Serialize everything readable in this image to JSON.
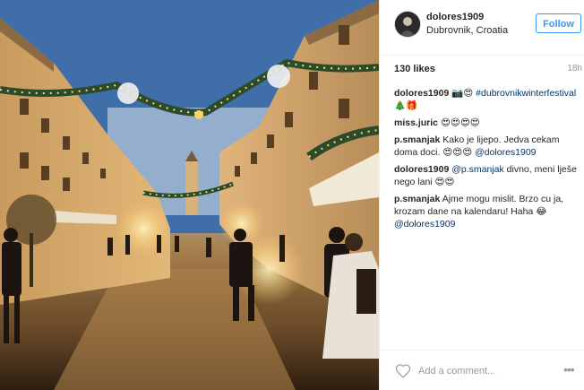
{
  "post": {
    "username": "dolores1909",
    "location": "Dubrovnik, Croatia",
    "follow_label": "Follow",
    "likes": "130 likes",
    "time": "18h"
  },
  "comments": [
    {
      "user": "dolores1909",
      "emoji1": "📷😍",
      "hashtag": "#dubrovnikwinterfestival",
      "emoji2": "🎄🎁"
    },
    {
      "user": "miss.juric",
      "emoji": "😍😍😍😍"
    },
    {
      "user": "p.smanjak",
      "text": "Kako je lijepo. Jedva cekam doma doci.",
      "emoji": "😍😍😍",
      "mention": "@dolores1909"
    },
    {
      "user": "dolores1909",
      "mention": "@p.smanjak",
      "text": "divno, meni lješe nego lani",
      "emoji": "😍😍"
    },
    {
      "user": "p.smanjak",
      "text": "Ajme mogu mislit. Brzo cu ja, krozam dane na kalendaru! Haha",
      "emoji": "😂",
      "mention": "@dolores1909"
    }
  ],
  "footer": {
    "add_comment_placeholder": "Add a comment...",
    "more_label": "•••"
  },
  "icons": {
    "heart": "heart-outline-icon",
    "more": "more-options-icon"
  },
  "colors": {
    "link": "#003569",
    "follow": "#3897f0",
    "secondary_text": "#999999"
  }
}
